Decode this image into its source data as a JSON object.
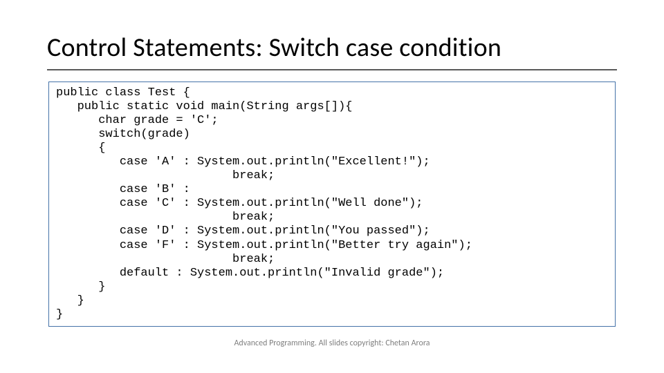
{
  "title": "Control Statements: Switch case condition",
  "code": "public class Test {\n   public static void main(String args[]){\n      char grade = 'C';\n      switch(grade)\n      {\n         case 'A' : System.out.println(\"Excellent!\");\n                         break;\n         case 'B' :\n         case 'C' : System.out.println(\"Well done\");\n                         break;\n         case 'D' : System.out.println(\"You passed\");\n         case 'F' : System.out.println(\"Better try again\");\n                         break;\n         default : System.out.println(\"Invalid grade\");\n      }\n   }\n}",
  "footer": "Advanced Programming. All slides copyright: Chetan Arora"
}
